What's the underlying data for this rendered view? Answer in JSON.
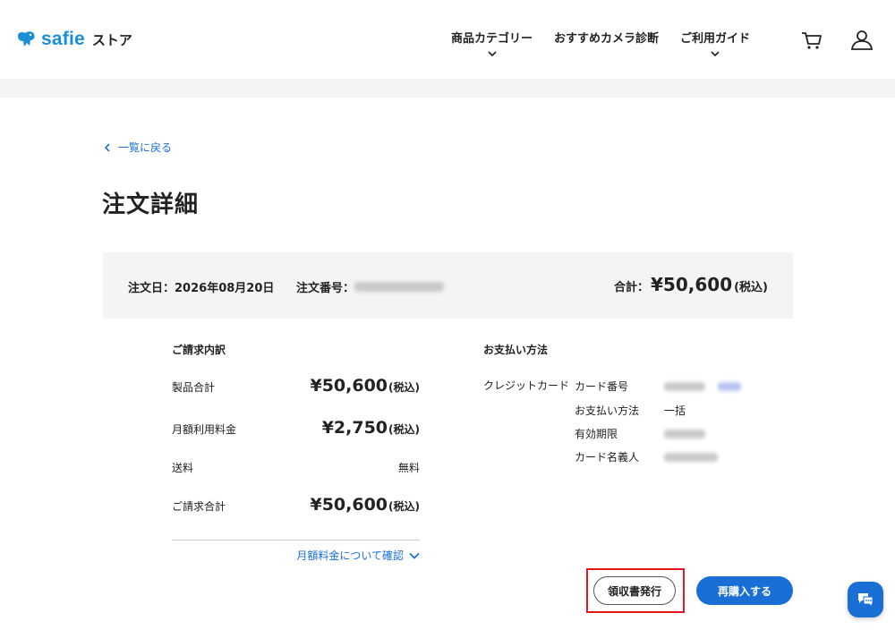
{
  "header": {
    "logo_text": "safie",
    "logo_suffix": "ストア",
    "nav": [
      {
        "label": "商品カテゴリー",
        "has_dropdown": true
      },
      {
        "label": "おすすめカメラ診断",
        "has_dropdown": false
      },
      {
        "label": "ご利用ガイド",
        "has_dropdown": true
      }
    ],
    "icons": [
      "cart-icon",
      "user-icon"
    ]
  },
  "back_link": "一覧に戻る",
  "page_title": "注文詳細",
  "summary": {
    "order_date_label": "注文日：",
    "order_date": "2026年08月20日",
    "order_no_label": "注文番号：",
    "total_label": "合計：",
    "total_amount": "¥50,600",
    "total_tax": "(税込)"
  },
  "billing": {
    "title": "ご請求内訳",
    "rows": [
      {
        "label": "製品合計",
        "amount": "¥50,600",
        "tax": "(税込)"
      },
      {
        "label": "月額利用料金",
        "amount": "¥2,750",
        "tax": "(税込)"
      },
      {
        "label": "送料",
        "plain": "無料"
      },
      {
        "label": "ご請求合計",
        "amount": "¥50,600",
        "tax": "(税込)"
      }
    ],
    "monthly_link": "月額料金について確認"
  },
  "payment": {
    "title": "お支払い方法",
    "method": "クレジットカード",
    "rows": [
      {
        "key": "カード番号"
      },
      {
        "key": "お支払い方法",
        "value": "一括"
      },
      {
        "key": "有効期限"
      },
      {
        "key": "カード名義人"
      }
    ]
  },
  "buttons": {
    "receipt": "領収書発行",
    "rebuy": "再購入する"
  },
  "colors": {
    "accent": "#1a6fd6",
    "brand": "#1a8fd6",
    "highlight": "#e0191a",
    "summary_bg": "#f4f4f4"
  }
}
